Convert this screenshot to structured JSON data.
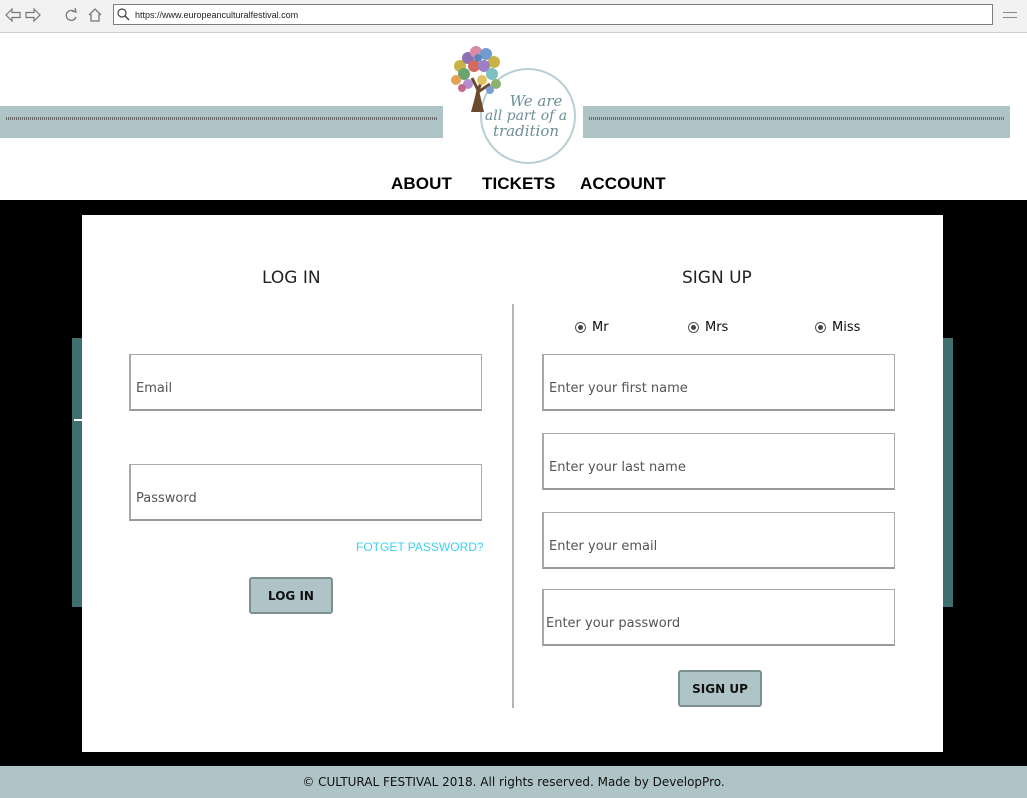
{
  "browser": {
    "url": "https://www.europeanculturalfestival.com",
    "icons": [
      "back-icon",
      "forward-icon",
      "reload-icon",
      "home-icon",
      "search-icon",
      "menu-icon"
    ]
  },
  "brand": {
    "logo_text": [
      "We are",
      "all part of a",
      "tradition"
    ]
  },
  "nav": {
    "items": [
      "ABOUT",
      "TICKETS",
      "ACCOUNT"
    ]
  },
  "login": {
    "title": "LOG IN",
    "email_placeholder": "Email",
    "password_placeholder": "Password",
    "forgot_label": "FOTGET PASSWORD?",
    "button_label": "LOG IN"
  },
  "signup": {
    "title": "SIGN UP",
    "titles": [
      "Mr",
      "Mrs",
      "Miss"
    ],
    "first_name_placeholder": "Enter your first name",
    "last_name_placeholder": "Enter your last name",
    "email_placeholder": "Enter your email",
    "password_placeholder": "Enter your password",
    "button_label": "SIGN UP"
  },
  "footer": {
    "text": "© CULTURAL FESTIVAL 2018. All rights reserved. Made by DevelopPro."
  },
  "colors": {
    "accent": "#afc4c6",
    "teal": "#3f6f6f",
    "link": "#3fd0f2",
    "dark_bg": "#000000"
  }
}
